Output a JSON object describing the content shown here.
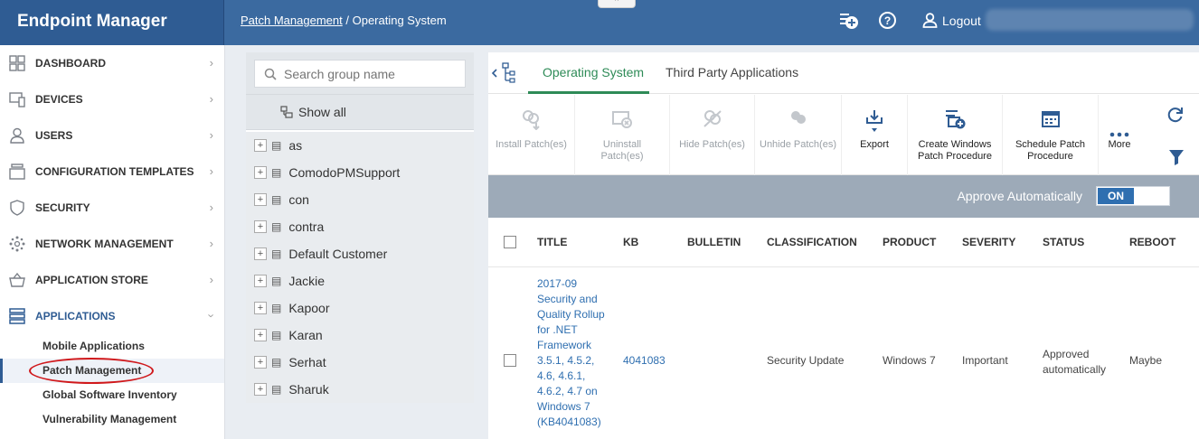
{
  "app": {
    "brand": "Endpoint Manager"
  },
  "header": {
    "breadcrumb_parent": "Patch Management",
    "breadcrumb_sep": "/",
    "breadcrumb_current": "Operating System",
    "logout_label": "Logout"
  },
  "sidebar": {
    "items": [
      {
        "label": "DASHBOARD",
        "icon": "grid-icon"
      },
      {
        "label": "DEVICES",
        "icon": "devices-icon"
      },
      {
        "label": "USERS",
        "icon": "user-icon"
      },
      {
        "label": "CONFIGURATION TEMPLATES",
        "icon": "templates-icon"
      },
      {
        "label": "SECURITY",
        "icon": "shield-icon"
      },
      {
        "label": "NETWORK MANAGEMENT",
        "icon": "network-icon"
      },
      {
        "label": "APPLICATION STORE",
        "icon": "basket-icon"
      },
      {
        "label": "APPLICATIONS",
        "icon": "applications-icon"
      }
    ],
    "subitems": [
      "Mobile Applications",
      "Patch Management",
      "Global Software Inventory",
      "Vulnerability Management"
    ]
  },
  "groups": {
    "search_placeholder": "Search group name",
    "show_all": "Show all",
    "list": [
      "as",
      "ComodoPMSupport",
      "con",
      "contra",
      "Default Customer",
      "Jackie",
      "Kapoor",
      "Karan",
      "Serhat",
      "Sharuk"
    ]
  },
  "tabs": {
    "os": "Operating System",
    "third_party": "Third Party Applications"
  },
  "toolbar": {
    "install": "Install Patch(es)",
    "uninstall": "Uninstall Patch(es)",
    "hide": "Hide Patch(es)",
    "unhide": "Unhide Patch(es)",
    "export": "Export",
    "create_windows": "Create Windows Patch Procedure",
    "schedule": "Schedule Patch Procedure",
    "more": "More"
  },
  "approve": {
    "label": "Approve Automatically",
    "state": "ON"
  },
  "table": {
    "headers": [
      "TITLE",
      "KB",
      "BULLETIN",
      "CLASSIFICATION",
      "PRODUCT",
      "SEVERITY",
      "STATUS",
      "REBOOT"
    ],
    "rows": [
      {
        "title": "2017-09 Security and Quality Rollup for .NET Framework 3.5.1, 4.5.2, 4.6, 4.6.1, 4.6.2, 4.7 on Windows 7 (KB4041083)",
        "kb": "4041083",
        "bulletin": "",
        "classification": "Security Update",
        "product": "Windows 7",
        "severity": "Important",
        "status": "Approved automatically",
        "reboot": "Maybe"
      }
    ]
  }
}
